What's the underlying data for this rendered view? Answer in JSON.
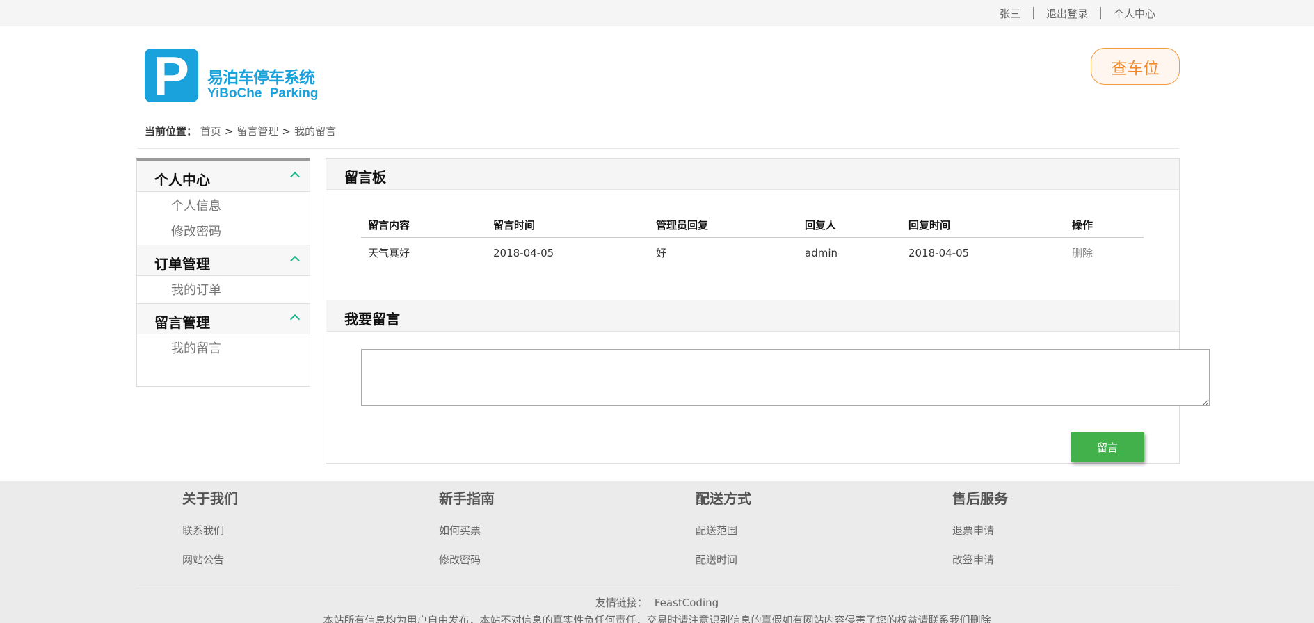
{
  "topbar": {
    "user": "张三",
    "logout": "退出登录",
    "center": "个人中心"
  },
  "brand": {
    "logo_letter": "P",
    "name_cn": "易泊车停车系统",
    "name_en": "YiBoChe Parking",
    "color": "#1aa2dc"
  },
  "find_spot_label": "查车位",
  "breadcrumb": {
    "label": "当前位置：",
    "items": [
      "首页",
      "留言管理",
      "我的留言"
    ],
    "sep": ">"
  },
  "sidebar": {
    "groups": [
      {
        "title": "个人中心",
        "items": [
          "个人信息",
          "修改密码"
        ]
      },
      {
        "title": "订单管理",
        "items": [
          "我的订单"
        ]
      },
      {
        "title": "留言管理",
        "items": [
          "我的留言"
        ]
      }
    ]
  },
  "board": {
    "title": "留言板",
    "columns": [
      "留言内容",
      "留言时间",
      "管理员回复",
      "回复人",
      "回复时间",
      "操作"
    ],
    "rows": [
      [
        "天气真好",
        "2018-04-05",
        "好",
        "admin",
        "2018-04-05",
        "删除"
      ]
    ]
  },
  "compose": {
    "title": "我要留言",
    "value": "",
    "submit": "留言",
    "submit_color": "#43b14b"
  },
  "footer": {
    "columns": [
      {
        "title": "关于我们",
        "links": [
          "联系我们",
          "网站公告"
        ]
      },
      {
        "title": "新手指南",
        "links": [
          "如何买票",
          "修改密码"
        ]
      },
      {
        "title": "配送方式",
        "links": [
          "配送范围",
          "配送时间"
        ]
      },
      {
        "title": "售后服务",
        "links": [
          "退票申请",
          "改签申请"
        ]
      }
    ],
    "friend_label": "友情链接：",
    "friend_link": "FeastCoding",
    "notice": "本站所有信息均为用户自由发布，本站不对信息的真实性负任何责任，交易时请注意识别信息的真假如有网站内容侵害了您的权益请联系我们删除"
  },
  "colors": {
    "accent_orange": "#f08a2a",
    "chevron_green": "#1db58a"
  }
}
